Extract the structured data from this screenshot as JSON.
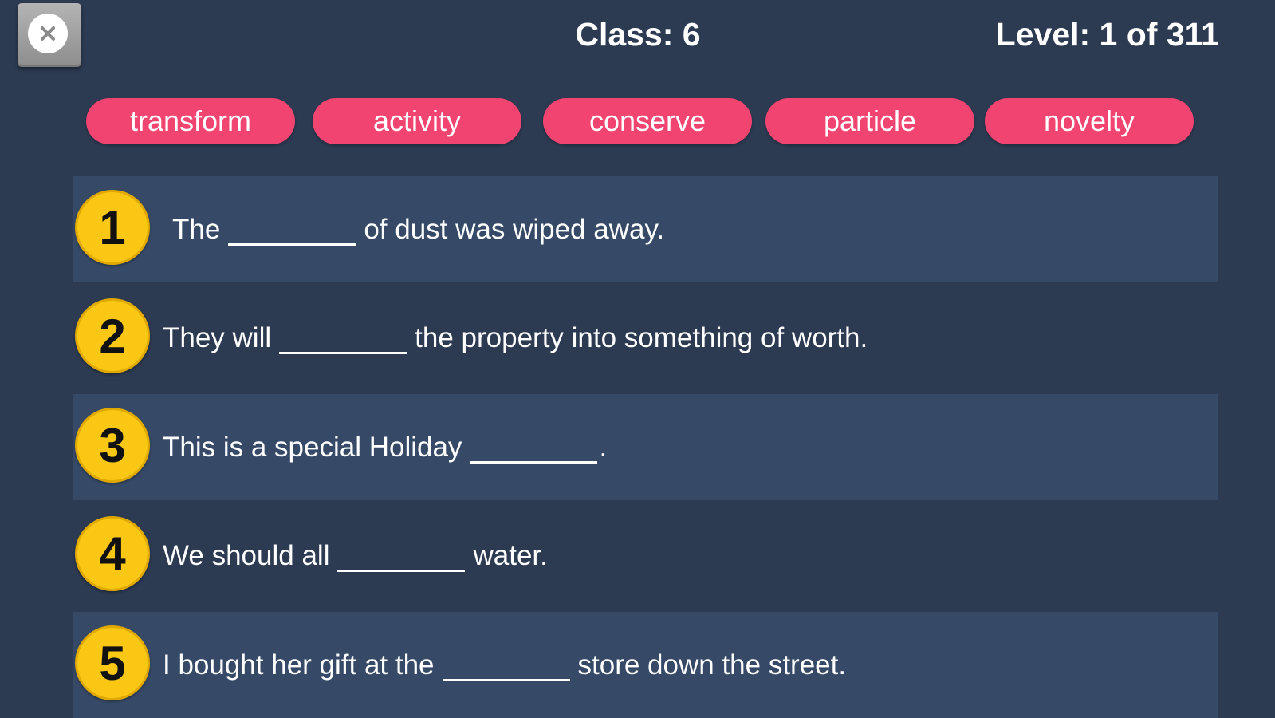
{
  "header": {
    "class_label": "Class: 6",
    "level_label": "Level: 1 of 311"
  },
  "words": [
    "transform",
    "activity",
    "conserve",
    "particle",
    "novelty"
  ],
  "questions": [
    {
      "number": "1",
      "before": "The",
      "after": "of dust was wiped away."
    },
    {
      "number": "2",
      "before": "They will",
      "after": "the property into something of worth."
    },
    {
      "number": "3",
      "before": "This is a special Holiday",
      "after": "."
    },
    {
      "number": "4",
      "before": "We should all",
      "after": "water."
    },
    {
      "number": "5",
      "before": "I bought her gift at the",
      "after": "store down the street."
    }
  ],
  "colors": {
    "background": "#2c3a52",
    "row_shade": "#364a68",
    "word_chip": "#f24470",
    "badge": "#f9c714"
  },
  "icons": {
    "close": "close-icon"
  }
}
